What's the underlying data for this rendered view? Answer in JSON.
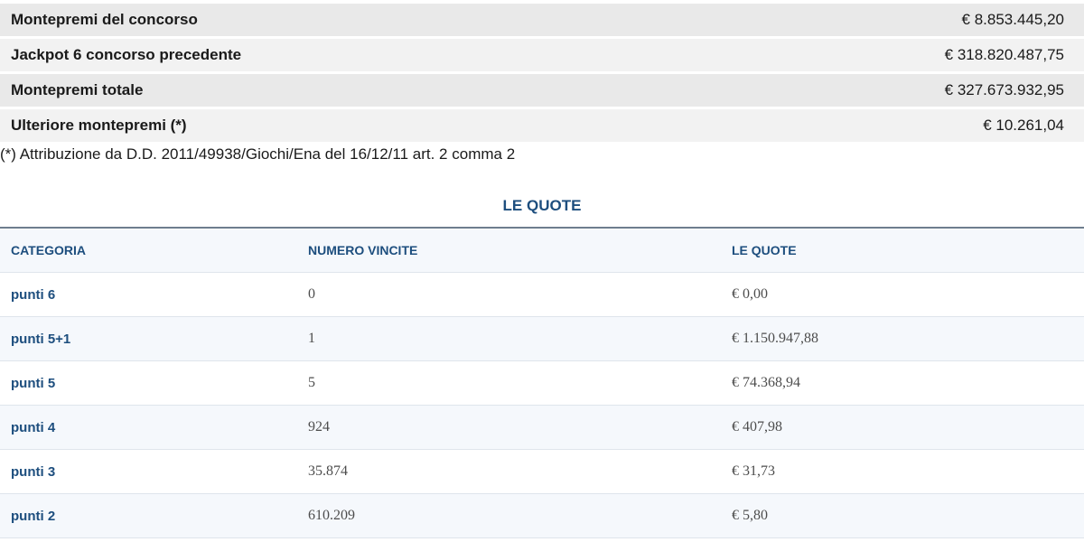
{
  "summary": {
    "rows": [
      {
        "label": "Montepremi del concorso",
        "value": "€ 8.853.445,20"
      },
      {
        "label": "Jackpot 6 concorso precedente",
        "value": "€ 318.820.487,75"
      },
      {
        "label": "Montepremi totale",
        "value": "€ 327.673.932,95"
      },
      {
        "label": "Ulteriore montepremi (*)",
        "value": "€ 10.261,04"
      }
    ]
  },
  "footnote": "(*) Attribuzione da D.D. 2011/49938/Giochi/Ena del 16/12/11 art. 2 comma 2",
  "quotes": {
    "title": "LE QUOTE",
    "headers": {
      "categoria": "CATEGORIA",
      "numero_vincite": "NUMERO VINCITE",
      "le_quote": "LE QUOTE"
    },
    "rows": [
      {
        "categoria": "punti 6",
        "numero_vincite": "0",
        "quota": "€ 0,00"
      },
      {
        "categoria": "punti 5+1",
        "numero_vincite": "1",
        "quota": "€ 1.150.947,88"
      },
      {
        "categoria": "punti 5",
        "numero_vincite": "5",
        "quota": "€ 74.368,94"
      },
      {
        "categoria": "punti 4",
        "numero_vincite": "924",
        "quota": "€ 407,98"
      },
      {
        "categoria": "punti 3",
        "numero_vincite": "35.874",
        "quota": "€ 31,73"
      },
      {
        "categoria": "punti 2",
        "numero_vincite": "610.209",
        "quota": "€ 5,80"
      }
    ]
  },
  "colors": {
    "heading_blue": "#1d4e7e",
    "row_shade_dark": "#e9e9e9",
    "row_shade_light": "#f2f2f2",
    "table_alt_row": "#f5f8fc"
  }
}
